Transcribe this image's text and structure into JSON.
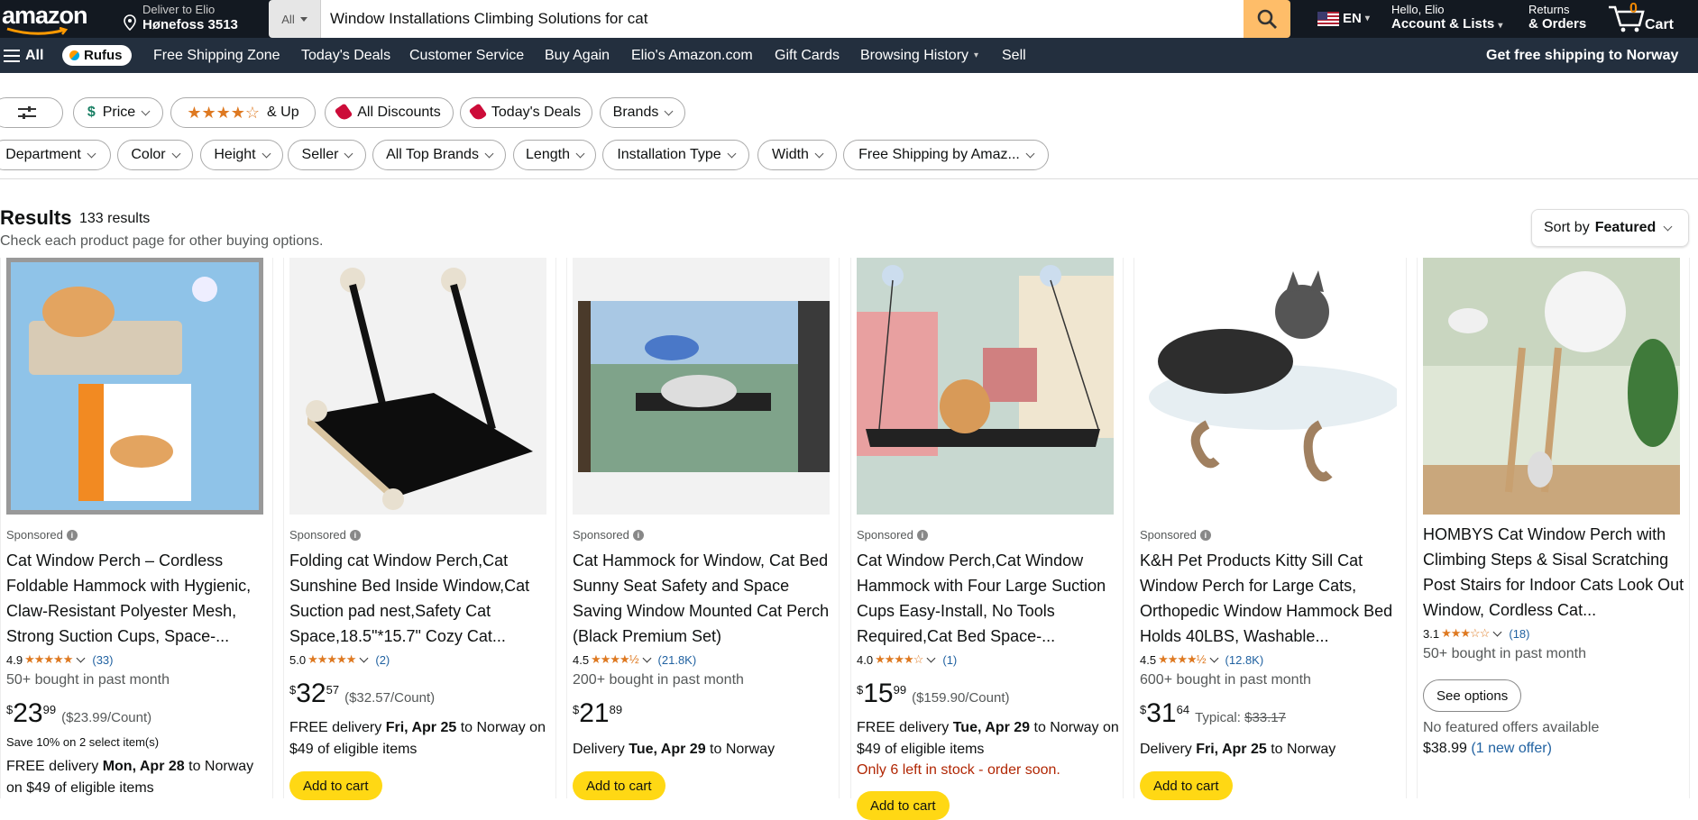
{
  "header": {
    "logo": "amazon",
    "deliver_line1": "Deliver to Elio",
    "deliver_line2": "Hønefoss 3513",
    "search_category": "All",
    "search_value": "Window Installations Climbing Solutions for cat",
    "lang": "EN",
    "account_line1": "Hello, Elio",
    "account_line2": "Account & Lists",
    "orders_line1": "Returns",
    "orders_line2": "& Orders",
    "cart_count": "0",
    "cart_label": "Cart"
  },
  "nav": {
    "all": "All",
    "rufus": "Rufus",
    "items": [
      "Free Shipping Zone",
      "Today's Deals",
      "Customer Service",
      "Buy Again",
      "Elio's Amazon.com",
      "Gift Cards",
      "Browsing History",
      "Sell"
    ],
    "promo": "Get free shipping to Norway"
  },
  "filters": {
    "row1": [
      "Price",
      "& Up",
      "All Discounts",
      "Today's Deals",
      "Brands"
    ],
    "row2": [
      "Department",
      "Color",
      "Height",
      "Seller",
      "All Top Brands",
      "Length",
      "Installation Type",
      "Width",
      "Free Shipping by Amaz..."
    ]
  },
  "results": {
    "title": "Results",
    "count": "133 results",
    "subtitle": "Check each product page for other buying options.",
    "sort_label": "Sort by",
    "sort_value": "Featured"
  },
  "products": [
    {
      "sponsored": "Sponsored",
      "title": "Cat Window Perch – Cordless Foldable Hammock with Hygienic, Claw-Resistant Polyester Mesh, Strong Suction Cups, Space-...",
      "rating": "4.9",
      "stars": "★★★★★",
      "reviews": "(33)",
      "bought": "50+ bought in past month",
      "price_sym": "$",
      "price_whole": "23",
      "price_frac": "99",
      "unit": "($23.99/Count)",
      "save": "Save 10% on 2 select item(s)",
      "delivery_pre": "FREE delivery ",
      "delivery_date": "Mon, Apr 28",
      "delivery_post": " to Norway on $49 of eligible items",
      "atc": "Add to cart"
    },
    {
      "sponsored": "Sponsored",
      "title": "Folding cat Window Perch,Cat Sunshine Bed Inside Window,Cat Suction pad nest,Safety Cat Space,18.5\"*15.7\" Cozy Cat...",
      "rating": "5.0",
      "stars": "★★★★★",
      "reviews": "(2)",
      "price_sym": "$",
      "price_whole": "32",
      "price_frac": "57",
      "unit": "($32.57/Count)",
      "delivery_pre": "FREE delivery ",
      "delivery_date": "Fri, Apr 25",
      "delivery_post": " to Norway on $49 of eligible items",
      "atc": "Add to cart"
    },
    {
      "sponsored": "Sponsored",
      "title": "Cat Hammock for Window, Cat Bed Sunny Seat Safety and Space Saving Window Mounted Cat Perch (Black Premium Set)",
      "rating": "4.5",
      "stars": "★★★★½",
      "reviews": "(21.8K)",
      "bought": "200+ bought in past month",
      "price_sym": "$",
      "price_whole": "21",
      "price_frac": "89",
      "delivery_pre": "Delivery ",
      "delivery_date": "Tue, Apr 29",
      "delivery_post": " to Norway",
      "atc": "Add to cart"
    },
    {
      "sponsored": "Sponsored",
      "title": "Cat Window Perch,Cat Window Hammock with Four Large Suction Cups Easy-Install, No Tools Required,Cat Bed Space-...",
      "rating": "4.0",
      "stars": "★★★★☆",
      "reviews": "(1)",
      "price_sym": "$",
      "price_whole": "15",
      "price_frac": "99",
      "unit": "($159.90/Count)",
      "delivery_pre": "FREE delivery ",
      "delivery_date": "Tue, Apr 29",
      "delivery_post": " to Norway on $49 of eligible items",
      "stock": "Only 6 left in stock - order soon.",
      "atc": "Add to cart"
    },
    {
      "sponsored": "Sponsored",
      "title": "K&H Pet Products Kitty Sill Cat Window Perch for Large Cats, Orthopedic Window Hammock Bed Holds 40LBS, Washable...",
      "rating": "4.5",
      "stars": "★★★★½",
      "reviews": "(12.8K)",
      "bought": "600+ bought in past month",
      "price_sym": "$",
      "price_whole": "31",
      "price_frac": "64",
      "typical_label": "Typical: ",
      "typical_price": "$33.17",
      "delivery_pre": "Delivery ",
      "delivery_date": "Fri, Apr 25",
      "delivery_post": " to Norway",
      "atc": "Add to cart"
    },
    {
      "title": "HOMBYS Cat Window Perch with Climbing Steps & Sisal Scratching Post Stairs for Indoor Cats Look Out Window, Cordless Cat...",
      "rating": "3.1",
      "stars": "★★★☆☆",
      "reviews": "(18)",
      "bought": "50+ bought in past month",
      "options": "See options",
      "no_offers": "No featured offers available",
      "other_price": "$38.99",
      "other_offer": "(1 new offer)"
    }
  ],
  "colors": {
    "header": "#131921",
    "nav": "#232f3e",
    "search_btn": "#febd69",
    "add_to_cart": "#ffd814",
    "star": "#de7921",
    "link": "#2162a1",
    "stock": "#b12704"
  }
}
